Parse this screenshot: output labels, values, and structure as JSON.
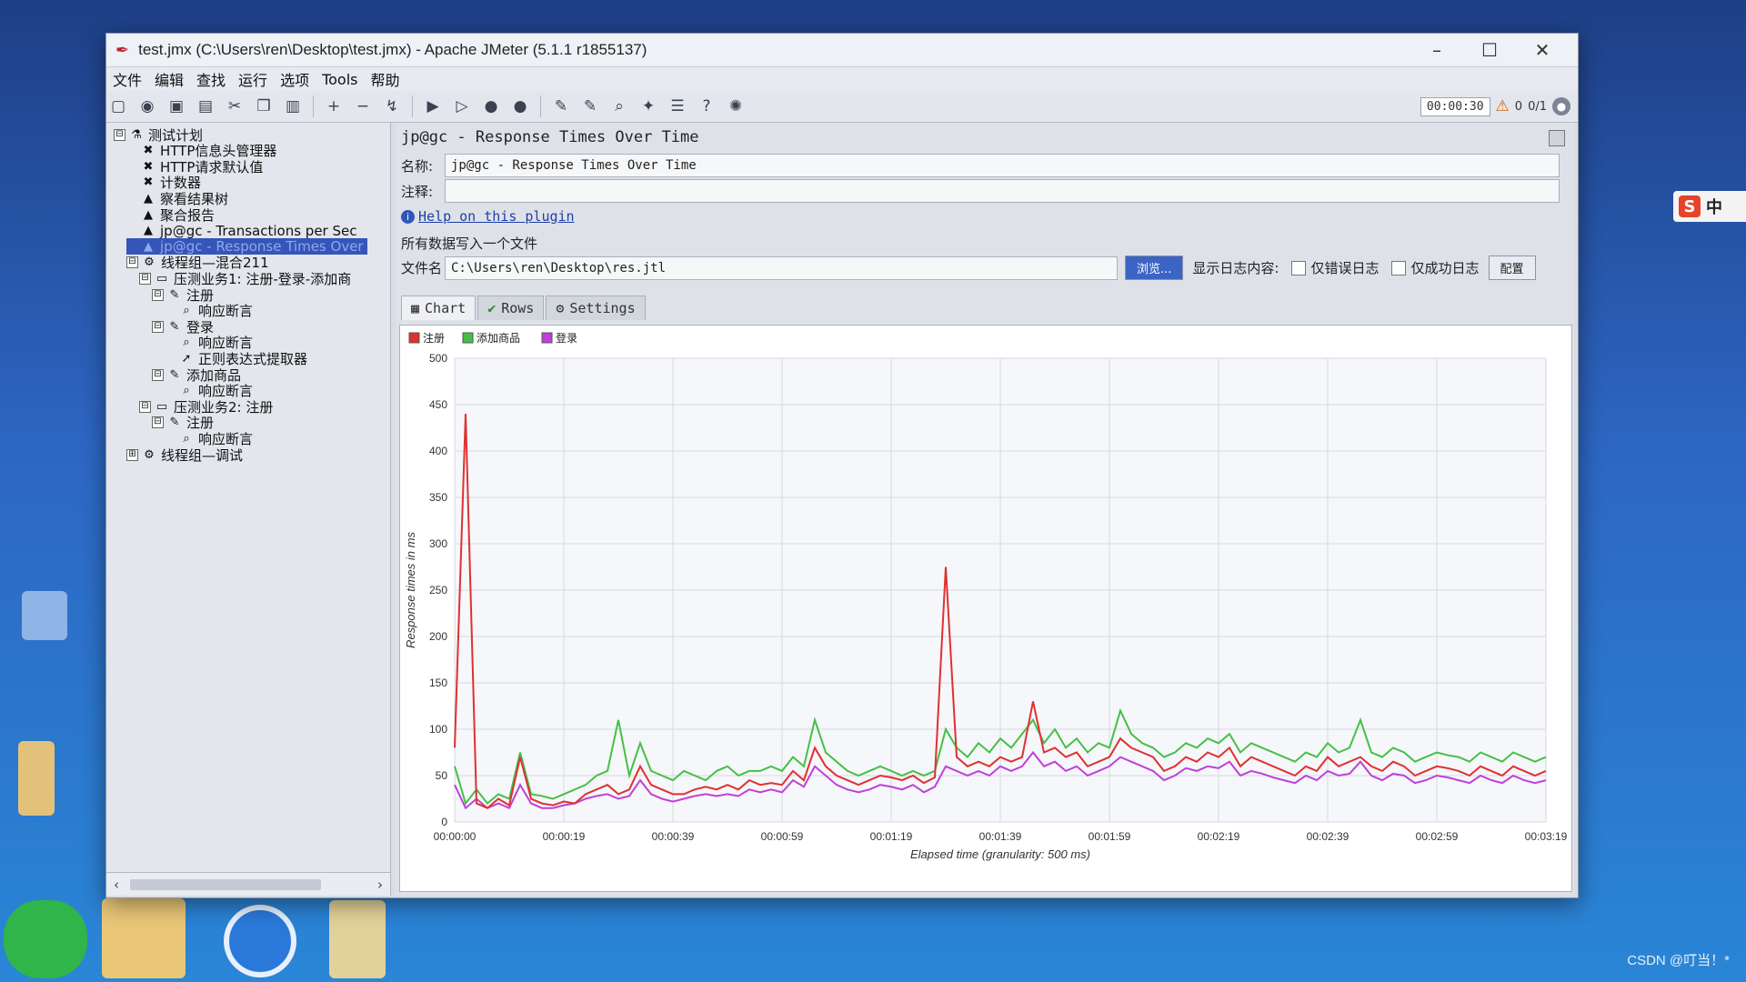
{
  "window": {
    "title": "test.jmx (C:\\Users\\ren\\Desktop\\test.jmx) - Apache JMeter (5.1.1 r1855137)",
    "controls": [
      "–",
      "☐",
      "✕"
    ]
  },
  "menu": [
    "文件",
    "编辑",
    "查找",
    "运行",
    "选项",
    "Tools",
    "帮助"
  ],
  "toolbar": {
    "timer": "00:00:30",
    "errors": "0",
    "threads": "0/1"
  },
  "tree": {
    "nodes": [
      {
        "label": "测试计划",
        "icon": "flask-icon",
        "level": 0,
        "expander": "⊟"
      },
      {
        "label": "HTTP信息头管理器",
        "icon": "wrench-icon",
        "level": 1
      },
      {
        "label": "HTTP请求默认值",
        "icon": "wrench-icon",
        "level": 1
      },
      {
        "label": "计数器",
        "icon": "wrench-icon",
        "level": 1
      },
      {
        "label": "察看结果树",
        "icon": "graph-icon",
        "level": 1
      },
      {
        "label": "聚合报告",
        "icon": "graph-icon",
        "level": 1
      },
      {
        "label": "jp@gc - Transactions per Sec",
        "icon": "graph-icon",
        "level": 1
      },
      {
        "label": "jp@gc - Response Times Over",
        "icon": "graph-icon",
        "level": 1,
        "selected": true
      },
      {
        "label": "线程组—混合211",
        "icon": "gear-icon",
        "level": 1,
        "expander": "⊟"
      },
      {
        "label": "压测业务1: 注册-登录-添加商",
        "icon": "folder-icon",
        "level": 2,
        "expander": "⊟"
      },
      {
        "label": "注册",
        "icon": "pen-icon",
        "level": 3,
        "expander": "⊟"
      },
      {
        "label": "响应断言",
        "icon": "magnifier-icon",
        "level": 4
      },
      {
        "label": "登录",
        "icon": "pen-icon",
        "level": 3,
        "expander": "⊟"
      },
      {
        "label": "响应断言",
        "icon": "magnifier-icon",
        "level": 4
      },
      {
        "label": "正则表达式提取器",
        "icon": "arrow-icon",
        "level": 4
      },
      {
        "label": "添加商品",
        "icon": "pen-icon",
        "level": 3,
        "expander": "⊟"
      },
      {
        "label": "响应断言",
        "icon": "magnifier-icon",
        "level": 4
      },
      {
        "label": "压测业务2: 注册",
        "icon": "folder-icon",
        "level": 2,
        "expander": "⊟"
      },
      {
        "label": "注册",
        "icon": "pen-icon",
        "level": 3,
        "expander": "⊟"
      },
      {
        "label": "响应断言",
        "icon": "magnifier-icon",
        "level": 4
      },
      {
        "label": "线程组—调试",
        "icon": "gear-icon",
        "level": 1,
        "expander": "⊞"
      }
    ]
  },
  "panel": {
    "title": "jp@gc - Response Times Over Time",
    "name_label": "名称:",
    "name_value": "jp@gc - Response Times Over Time",
    "comment_label": "注释:",
    "comment_value": "",
    "help_link": "Help on this plugin",
    "write_all_label": "所有数据写入一个文件",
    "filename_label": "文件名",
    "filename_value": "C:\\Users\\ren\\Desktop\\res.jtl",
    "browse_button": "浏览...",
    "log_display_label": "显示日志内容:",
    "errors_only_label": "仅错误日志",
    "success_only_label": "仅成功日志",
    "config_button": "配置",
    "tabs": [
      "Chart",
      "Rows",
      "Settings"
    ]
  },
  "colors": {
    "注册": "#e03030",
    "添加商品": "#45c045",
    "登录": "#c040d8"
  },
  "chart_data": {
    "type": "line",
    "xlabel": "Elapsed time (granularity: 500 ms)",
    "ylabel": "Response times in ms",
    "ylim": [
      0,
      500
    ],
    "yticks": [
      0,
      50,
      100,
      150,
      200,
      250,
      300,
      350,
      400,
      450,
      500
    ],
    "xticks": [
      "00:00:00",
      "00:00:19",
      "00:00:39",
      "00:00:59",
      "00:01:19",
      "00:01:39",
      "00:01:59",
      "00:02:19",
      "00:02:39",
      "00:02:59",
      "00:03:19"
    ],
    "x_seconds": [
      0,
      2,
      4,
      6,
      8,
      10,
      12,
      14,
      16,
      18,
      20,
      22,
      24,
      26,
      28,
      30,
      32,
      34,
      36,
      38,
      40,
      42,
      44,
      46,
      48,
      50,
      52,
      54,
      56,
      58,
      60,
      62,
      64,
      66,
      68,
      70,
      72,
      74,
      76,
      78,
      80,
      82,
      84,
      86,
      88,
      90,
      92,
      94,
      96,
      98,
      100,
      102,
      104,
      106,
      108,
      110,
      112,
      114,
      116,
      118,
      120,
      122,
      124,
      126,
      128,
      130,
      132,
      134,
      136,
      138,
      140,
      142,
      144,
      146,
      148,
      150,
      152,
      154,
      156,
      158,
      160,
      162,
      164,
      166,
      168,
      170,
      172,
      174,
      176,
      178,
      180,
      182,
      184,
      186,
      188,
      190,
      192,
      194,
      196,
      198,
      200
    ],
    "series": [
      {
        "name": "注册",
        "values": [
          80,
          440,
          20,
          15,
          25,
          18,
          70,
          25,
          20,
          18,
          22,
          20,
          30,
          35,
          40,
          30,
          35,
          60,
          40,
          35,
          30,
          30,
          35,
          38,
          35,
          40,
          35,
          45,
          40,
          42,
          40,
          55,
          45,
          80,
          60,
          50,
          45,
          40,
          45,
          50,
          48,
          45,
          50,
          42,
          48,
          275,
          70,
          60,
          65,
          60,
          70,
          65,
          70,
          130,
          75,
          80,
          70,
          75,
          60,
          65,
          70,
          90,
          80,
          75,
          70,
          55,
          60,
          70,
          65,
          75,
          70,
          80,
          60,
          70,
          65,
          60,
          55,
          50,
          60,
          55,
          70,
          60,
          65,
          70,
          60,
          55,
          65,
          60,
          50,
          55,
          60,
          58,
          55,
          50,
          60,
          55,
          50,
          60,
          55,
          50,
          55
        ]
      },
      {
        "name": "添加商品",
        "values": [
          60,
          20,
          35,
          20,
          30,
          25,
          75,
          30,
          28,
          25,
          30,
          35,
          40,
          50,
          55,
          110,
          50,
          85,
          55,
          50,
          45,
          55,
          50,
          45,
          55,
          60,
          50,
          55,
          55,
          60,
          55,
          70,
          60,
          110,
          75,
          65,
          55,
          50,
          55,
          60,
          55,
          50,
          55,
          50,
          55,
          100,
          80,
          70,
          85,
          75,
          90,
          80,
          95,
          110,
          85,
          100,
          80,
          90,
          75,
          85,
          80,
          120,
          95,
          85,
          80,
          70,
          75,
          85,
          80,
          90,
          85,
          95,
          75,
          85,
          80,
          75,
          70,
          65,
          75,
          70,
          85,
          75,
          80,
          110,
          75,
          70,
          80,
          75,
          65,
          70,
          75,
          72,
          70,
          65,
          75,
          70,
          65,
          75,
          70,
          65,
          70
        ]
      },
      {
        "name": "登录",
        "values": [
          40,
          15,
          25,
          15,
          20,
          15,
          40,
          20,
          15,
          15,
          18,
          20,
          25,
          28,
          30,
          25,
          28,
          45,
          30,
          25,
          22,
          25,
          28,
          30,
          28,
          30,
          28,
          35,
          32,
          35,
          32,
          45,
          38,
          60,
          50,
          40,
          35,
          32,
          35,
          40,
          38,
          35,
          40,
          32,
          38,
          60,
          55,
          50,
          55,
          50,
          60,
          55,
          60,
          75,
          60,
          65,
          55,
          60,
          50,
          55,
          60,
          70,
          65,
          60,
          55,
          45,
          50,
          58,
          55,
          60,
          58,
          65,
          50,
          55,
          52,
          48,
          45,
          42,
          50,
          45,
          55,
          50,
          52,
          65,
          50,
          45,
          52,
          50,
          42,
          45,
          50,
          48,
          45,
          42,
          50,
          45,
          42,
          50,
          45,
          42,
          45
        ]
      }
    ]
  },
  "desktop": {
    "watermark": "CSDN @叮当！*",
    "ime": {
      "s": "S",
      "mode": "中"
    }
  }
}
